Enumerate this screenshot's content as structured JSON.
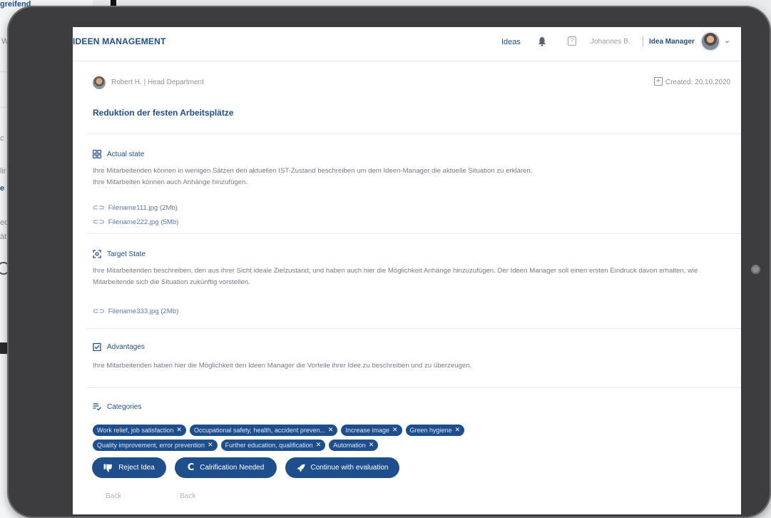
{
  "background": {
    "top_text": "greifend",
    "fragments": [
      "W",
      "c",
      "lir",
      "e",
      "ec",
      "ät"
    ]
  },
  "header": {
    "brand": "IDEEN MANAGEMENT",
    "nav_ideas": "Ideas",
    "help_icon_text": "?",
    "user_name": "Johannes B.",
    "role": "Idea Manager",
    "chevron": "⌄"
  },
  "idea": {
    "author": "Robert H. | Head Department",
    "created": "Created: 20.10.2020",
    "title": "Reduktion der festen Arbeitsplätze",
    "actual_state": {
      "heading": "Actual state",
      "text": "Ihre Mitarbeitenden können in wenigen Sätzen den aktuellen IST-Zustand beschreiben um dem Ideen-Manager die aktuelle Situation zu erklären.\nIhre Mitarbeiten können auch Anhänge hinzufügen.",
      "files": [
        "Filename111.jpg (2Mb)",
        "Filename222.jpg (5Mb)"
      ]
    },
    "target_state": {
      "heading": "Target State",
      "text": "Ihre Mitarbeitenden beschreiben, den aus ihrer Sicht ideale Zielzustand, und haben auch hier die Möglichkeit Anhänge hinzuzufügen. Der Ideen Manager soll einen ersten Eindruck davon erhalten, wie Mitarbeitende sich die Situation zukünftig vorstellen.",
      "files": [
        "Filename333.jpg (2Mb)"
      ]
    },
    "advantages": {
      "heading": "Advantages",
      "text": "Ihre Mitarbeitenden haben hier die Möglichkeit den Ideen Manager die Vorteile ihrer Idee zu beschreiben und zu überzeugen."
    },
    "categories": {
      "heading": "Categories",
      "row1": [
        "Work relief, job satisfaction",
        "Occupational safety, health, accident preven...",
        "Increase image",
        "Green hygiene"
      ],
      "row2": [
        "Quality improvement, error prevention",
        "Further education, qualification",
        "Automation"
      ]
    }
  },
  "actions": {
    "reject": "Reject Idea",
    "clarify": "Calrification Needed",
    "continue": "Continue with evaluation",
    "back1": "Back",
    "back2": "Back"
  },
  "colors": {
    "primary": "#1f4e8c",
    "muted_text": "#767c86",
    "device": "#3d3d3f"
  }
}
